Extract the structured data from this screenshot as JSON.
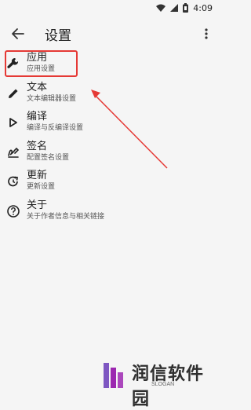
{
  "status_bar": {
    "time": "4:09",
    "icons": [
      "wifi-icon",
      "signal-icon",
      "battery-icon"
    ]
  },
  "toolbar": {
    "title": "设置",
    "back_icon": "arrow-back-icon",
    "more_icon": "more-vert-icon"
  },
  "settings": {
    "items": [
      {
        "label": "应用",
        "sub": "应用设置",
        "icon": "wrench-icon"
      },
      {
        "label": "文本",
        "sub": "文本编辑器设置",
        "icon": "pencil-icon"
      },
      {
        "label": "编译",
        "sub": "编译与反编译设置",
        "icon": "play-icon"
      },
      {
        "label": "签名",
        "sub": "配置签名设置",
        "icon": "signature-icon"
      },
      {
        "label": "更新",
        "sub": "更新设置",
        "icon": "update-icon"
      },
      {
        "label": "关于",
        "sub": "关于作者信息与相关链接",
        "icon": "help-icon"
      }
    ]
  },
  "annotation": {
    "highlight_color": "#e53935"
  },
  "watermark": {
    "brand": "润信软件园",
    "slogan": "SLOGAN"
  }
}
